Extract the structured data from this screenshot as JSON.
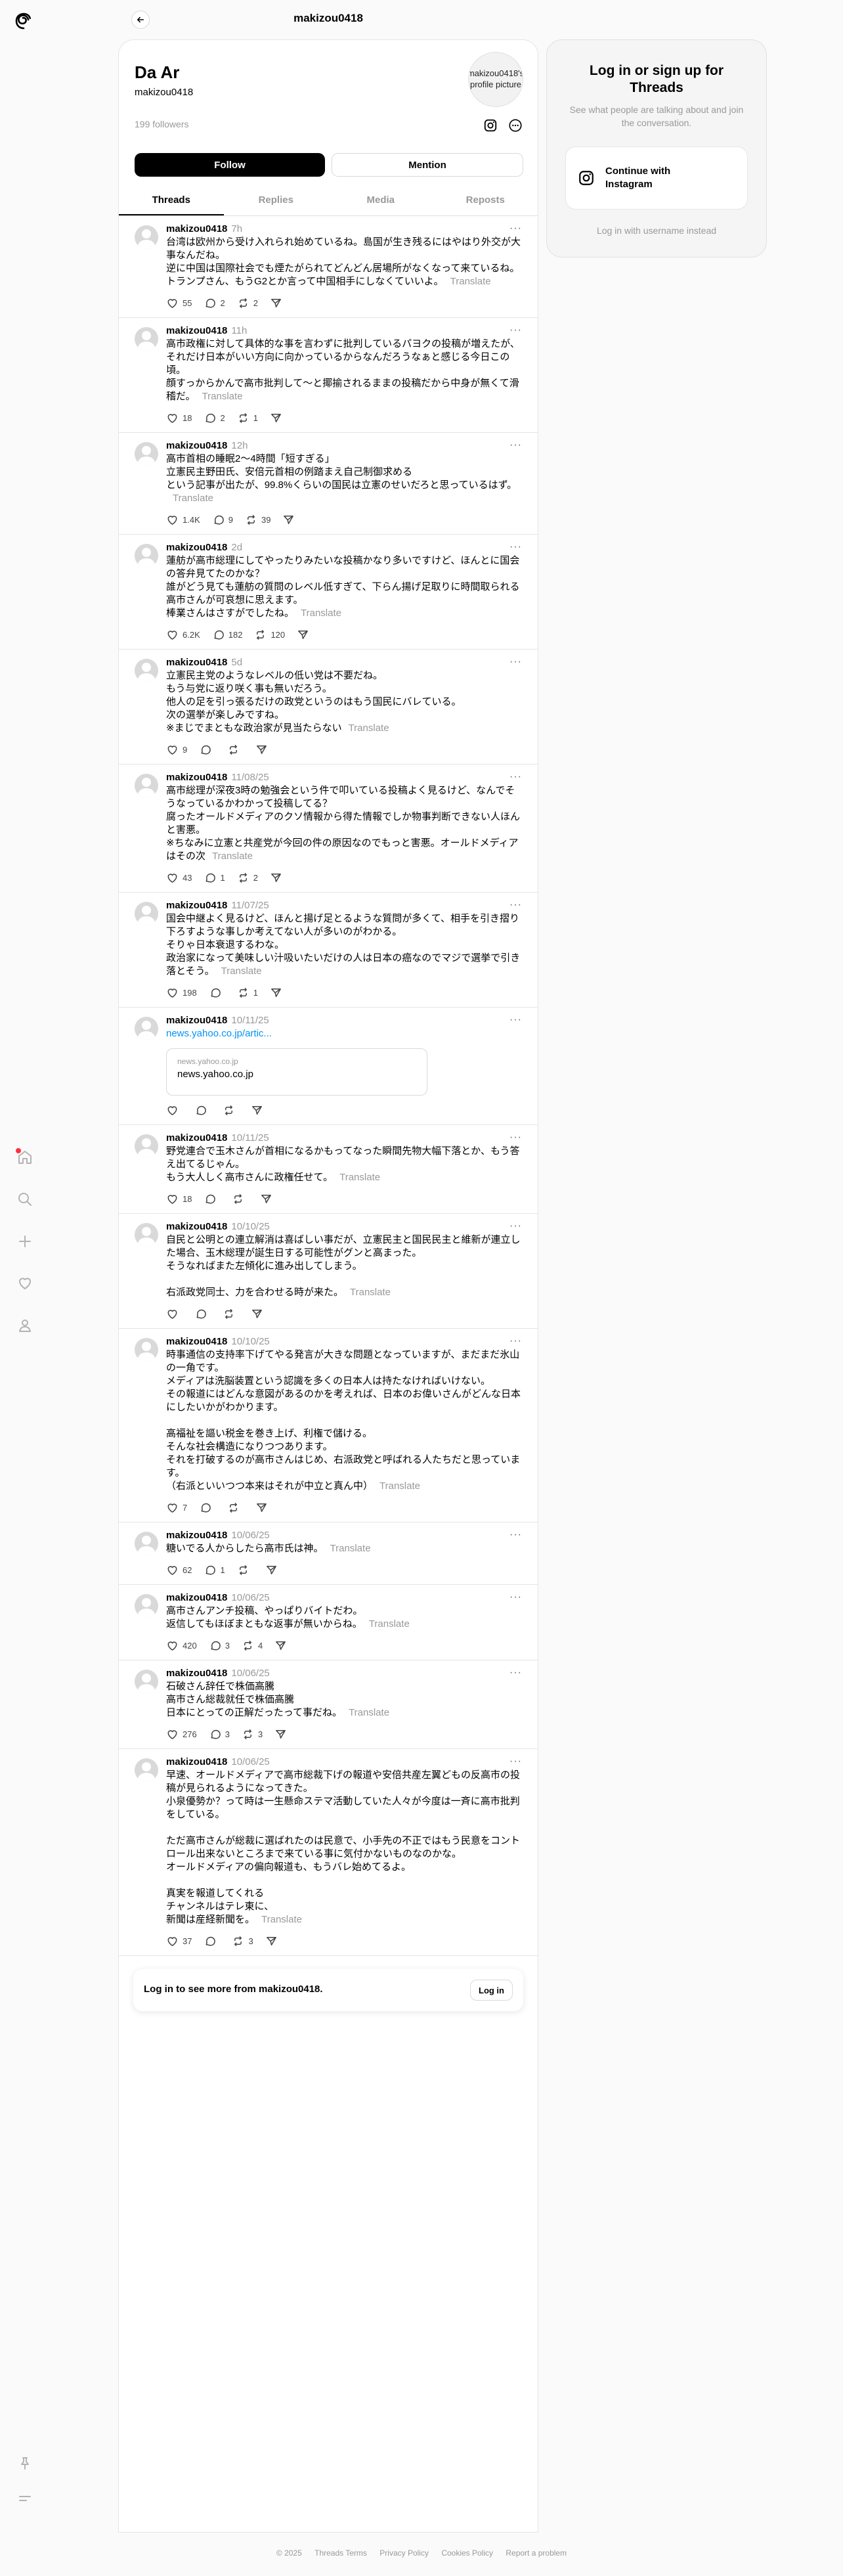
{
  "nav": {
    "items": [
      "home",
      "search",
      "create",
      "activity",
      "profile"
    ],
    "bottom": [
      "pin",
      "menu"
    ]
  },
  "header": {
    "title": "makizou0418"
  },
  "profile": {
    "name": "Da Ar",
    "handle": "makizou0418",
    "avatar_alt": "makizou0418's profile picture",
    "followers": "199 followers",
    "follow_label": "Follow",
    "mention_label": "Mention"
  },
  "tabs": [
    "Threads",
    "Replies",
    "Media",
    "Reposts"
  ],
  "translate_label": "Translate",
  "posts": [
    {
      "user": "makizou0418",
      "time": "7h",
      "text": "台湾は欧州から受け入れられ始めているね。島国が生き残るにはやはり外交が大事なんだね。\n逆に中国は国際社会でも煙たがられてどんどん居場所がなくなって来ているね。\nトランプさん、もうG2とか言って中国相手にしなくていいよ。",
      "likes": "55",
      "replies": "2",
      "reposts": "2"
    },
    {
      "user": "makizou0418",
      "time": "11h",
      "text": "高市政権に対して具体的な事を言わずに批判しているパヨクの投稿が増えたが、それだけ日本がいい方向に向かっているからなんだろうなぁと感じる今日この頃。\n顔すっからかんで高市批判して〜と揶揄されるままの投稿だから中身が無くて滑稽だ。",
      "likes": "18",
      "replies": "2",
      "reposts": "1"
    },
    {
      "user": "makizou0418",
      "time": "12h",
      "text": "高市首相の睡眠2〜4時間「短すぎる」\n立憲民主野田氏、安倍元首相の例踏まえ自己制御求める\nという記事が出たが、99.8%くらいの国民は立憲のせいだろと思っているはず。",
      "likes": "1.4K",
      "replies": "9",
      "reposts": "39"
    },
    {
      "user": "makizou0418",
      "time": "2d",
      "text": "蓮舫が高市総理にしてやったりみたいな投稿かなり多いですけど、ほんとに国会の答弁見てたのかな？\n誰がどう見ても蓮舫の質問のレベル低すぎて、下らん揚げ足取りに時間取られる高市さんが可哀想に思えます。\n棒業さんはさすがでしたね。",
      "likes": "6.2K",
      "replies": "182",
      "reposts": "120"
    },
    {
      "user": "makizou0418",
      "time": "5d",
      "text": "立憲民主党のようなレベルの低い党は不要だね。\nもう与党に返り咲く事も無いだろう。\n他人の足を引っ張るだけの政党というのはもう国民にバレている。\n次の選挙が楽しみですね。\n※まじでまともな政治家が見当たらない",
      "likes": "9",
      "replies": "",
      "reposts": ""
    },
    {
      "user": "makizou0418",
      "time": "11/08/25",
      "text": "高市総理が深夜3時の勉強会という件で叩いている投稿よく見るけど、なんでそうなっているかわかって投稿してる？\n腐ったオールドメディアのクソ情報から得た情報でしか物事判断できない人ほんと害悪。\n※ちなみに立憲と共産党が今回の件の原因なのでもっと害悪。オールドメディアはその次",
      "likes": "43",
      "replies": "1",
      "reposts": "2"
    },
    {
      "user": "makizou0418",
      "time": "11/07/25",
      "text": "国会中継よく見るけど、ほんと揚げ足とるような質問が多くて、相手を引き摺り下ろすような事しか考えてない人が多いのがわかる。\nそりゃ日本衰退するわな。\n政治家になって美味しい汁吸いたいだけの人は日本の癌なのでマジで選挙で引き落とそう。",
      "likes": "198",
      "replies": "",
      "reposts": "1"
    },
    {
      "user": "makizou0418",
      "time": "10/11/25",
      "text": "",
      "link": "news.yahoo.co.jp/artic...",
      "card_domain": "news.yahoo.co.jp",
      "card_title": "news.yahoo.co.jp",
      "likes": "",
      "replies": "",
      "reposts": ""
    },
    {
      "user": "makizou0418",
      "time": "10/11/25",
      "text": "野党連合で玉木さんが首相になるかもってなった瞬間先物大幅下落とか、もう答え出てるじゃん。\nもう大人しく高市さんに政権任せて。",
      "likes": "18",
      "replies": "",
      "reposts": ""
    },
    {
      "user": "makizou0418",
      "time": "10/10/25",
      "text": "自民と公明との連立解消は喜ばしい事だが、立憲民主と国民民主と維新が連立した場合、玉木総理が誕生日する可能性がグンと高まった。\nそうなればまた左傾化に進み出してしまう。\n\n右派政党同士、力を合わせる時が来た。",
      "likes": "",
      "replies": "",
      "reposts": ""
    },
    {
      "user": "makizou0418",
      "time": "10/10/25",
      "text": "時事通信の支持率下げてやる発言が大きな問題となっていますが、まだまだ氷山の一角です。\nメディアは洗脳装置という認識を多くの日本人は持たなければいけない。\nその報道にはどんな意図があるのかを考えれば、日本のお偉いさんがどんな日本にしたいかがわかります。\n\n高福祉を謳い税金を巻き上げ、利権で儲ける。\nそんな社会構造になりつつあります。\nそれを打破するのが高市さんはじめ、右派政党と呼ばれる人たちだと思っています。\n（右派といいつつ本来はそれが中立と真ん中）",
      "likes": "7",
      "replies": "",
      "reposts": ""
    },
    {
      "user": "makizou0418",
      "time": "10/06/25",
      "text": "糖いでる人からしたら高市氏は神。",
      "likes": "62",
      "replies": "1",
      "reposts": ""
    },
    {
      "user": "makizou0418",
      "time": "10/06/25",
      "text": "高市さんアンチ投稿、やっぱりバイトだわ。\n返信してもほぼまともな返事が無いからね。",
      "likes": "420",
      "replies": "3",
      "reposts": "4"
    },
    {
      "user": "makizou0418",
      "time": "10/06/25",
      "text": "石破さん辞任で株価高騰\n高市さん総裁就任で株価高騰\n日本にとっての正解だったって事だね。",
      "likes": "276",
      "replies": "3",
      "reposts": "3"
    },
    {
      "user": "makizou0418",
      "time": "10/06/25",
      "text": "早速、オールドメディアで高市総裁下げの報道や安倍共産左翼どもの反高市の投稿が見られるようになってきた。\n小泉優勢か？って時は一生懸命ステマ活動していた人々が今度は一斉に高市批判をしている。\n\nただ高市さんが総裁に選ばれたのは民意で、小手先の不正ではもう民意をコントロール出来ないところまで来ている事に気付かないものなのかな。\nオールドメディアの偏向報道も、もうバレ始めてるよ。\n\n真実を報道してくれる\nチャンネルはテレ東に、\n新聞は産経新聞を。",
      "likes": "37",
      "replies": "",
      "reposts": "3"
    }
  ],
  "login_more": {
    "text": "Log in to see more from makizou0418.",
    "button": "Log in"
  },
  "side": {
    "title": "Log in or sign up for Threads",
    "subtitle": "See what people are talking about and join the conversation.",
    "instagram_label": "Continue with Instagram",
    "alt_login": "Log in with username instead"
  },
  "footer": [
    "© 2025",
    "Threads Terms",
    "Privacy Policy",
    "Cookies Policy",
    "Report a problem"
  ]
}
